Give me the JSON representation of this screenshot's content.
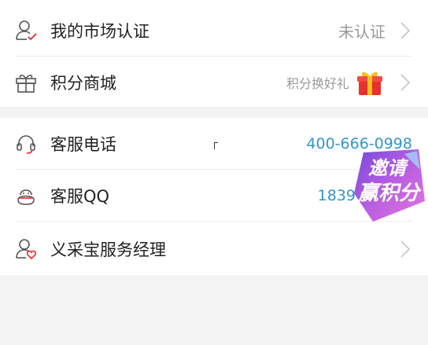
{
  "section1": {
    "market_cert": {
      "label": "我的市场认证",
      "value": "未认证"
    },
    "points_mall": {
      "label": "积分商城",
      "value": "积分换好礼"
    }
  },
  "section2": {
    "service_phone": {
      "label": "客服电话",
      "value": "400-666-0998"
    },
    "service_qq": {
      "label": "客服QQ",
      "value": "1839"
    },
    "manager": {
      "label": "义采宝服务经理"
    }
  },
  "badge": {
    "line1": "邀请",
    "line2": "赢积分"
  },
  "colors": {
    "accent_red": "#e4393c",
    "phone_blue": "#3296ca"
  }
}
